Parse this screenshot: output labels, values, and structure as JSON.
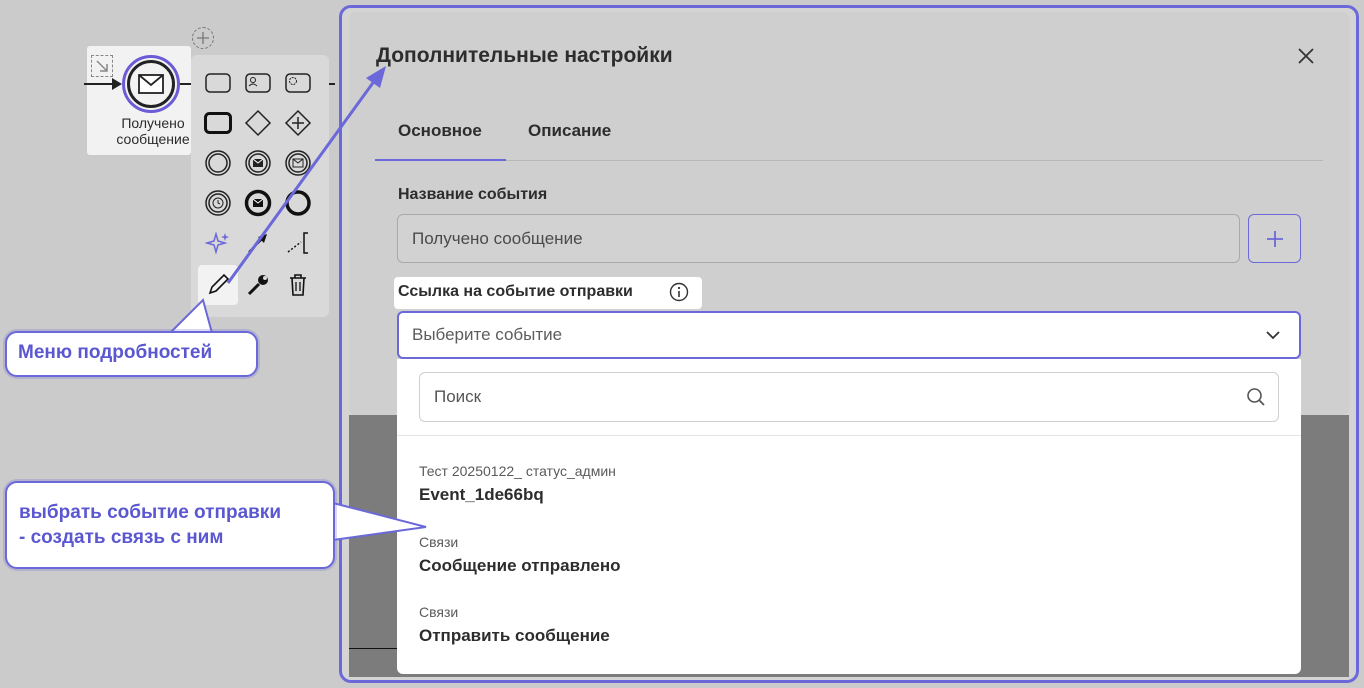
{
  "canvas": {
    "event_label": "Получено сообщение"
  },
  "callouts": {
    "details_menu": "Меню подробностей",
    "choose_event_line1": "выбрать событие отправки",
    "choose_event_line2": "- создать связь с ним"
  },
  "dialog": {
    "title": "Дополнительные настройки",
    "tabs": [
      {
        "label": "Основное",
        "active": true
      },
      {
        "label": "Описание",
        "active": false
      }
    ],
    "event_name_label": "Название события",
    "event_name_value": "Получено сообщение",
    "send_event_link_label": "Ссылка на событие отправки",
    "select_placeholder": "Выберите событие",
    "search_placeholder": "Поиск",
    "options": [
      {
        "group": "Тест 20250122_ статус_админ",
        "name": "Event_1de66bq"
      },
      {
        "group": "Связи",
        "name": "Сообщение отправлено"
      },
      {
        "group": "Связи",
        "name": "Отправить сообщение"
      }
    ]
  },
  "colors": {
    "accent": "#6b68d9",
    "callout_text": "#5a57d1",
    "dialog_bg": "#cfcfcf"
  }
}
